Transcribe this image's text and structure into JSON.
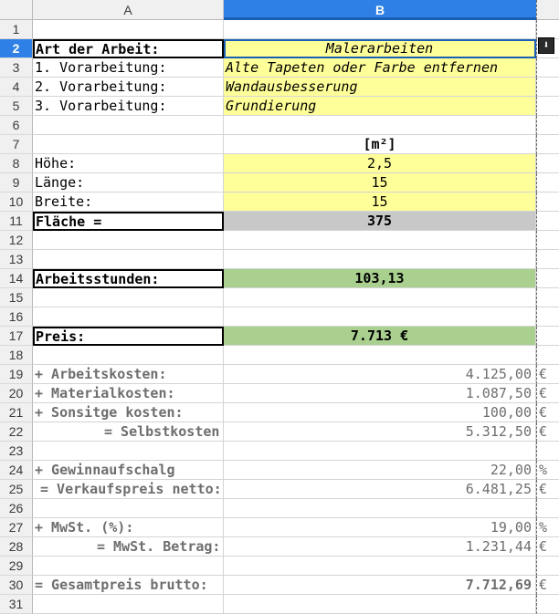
{
  "columns": {
    "a": "A",
    "b": "B"
  },
  "rows": [
    {
      "num": "1",
      "a": "",
      "b": "",
      "c": ""
    },
    {
      "num": "2",
      "a": "Art der Arbeit:",
      "b": "Malerarbeiten",
      "c": ""
    },
    {
      "num": "3",
      "a": "1. Vorarbeitung:",
      "b": "Alte Tapeten oder Farbe entfernen",
      "c": ""
    },
    {
      "num": "4",
      "a": "2. Vorarbeitung:",
      "b": "Wandausbesserung",
      "c": ""
    },
    {
      "num": "5",
      "a": "3. Vorarbeitung:",
      "b": "Grundierung",
      "c": ""
    },
    {
      "num": "6",
      "a": "",
      "b": "",
      "c": ""
    },
    {
      "num": "7",
      "a": "",
      "b": "[m²]",
      "c": ""
    },
    {
      "num": "8",
      "a": "Höhe:",
      "b": "2,5",
      "c": ""
    },
    {
      "num": "9",
      "a": "Länge:",
      "b": "15",
      "c": ""
    },
    {
      "num": "10",
      "a": "Breite:",
      "b": "15",
      "c": ""
    },
    {
      "num": "11",
      "a": "Fläche =",
      "b": "375",
      "c": ""
    },
    {
      "num": "12",
      "a": "",
      "b": "",
      "c": ""
    },
    {
      "num": "13",
      "a": "",
      "b": "",
      "c": ""
    },
    {
      "num": "14",
      "a": "Arbeitsstunden:",
      "b": "103,13",
      "c": ""
    },
    {
      "num": "15",
      "a": "",
      "b": "",
      "c": ""
    },
    {
      "num": "16",
      "a": "",
      "b": "",
      "c": ""
    },
    {
      "num": "17",
      "a": "Preis:",
      "b": "7.713 €",
      "c": ""
    },
    {
      "num": "18",
      "a": "",
      "b": "",
      "c": ""
    },
    {
      "num": "19",
      "a": "+ Arbeitskosten:",
      "b": "4.125,00",
      "c": "€"
    },
    {
      "num": "20",
      "a": "+ Materialkosten:",
      "b": "1.087,50",
      "c": "€"
    },
    {
      "num": "21",
      "a": "+ Sonsitge kosten:",
      "b": "100,00",
      "c": "€"
    },
    {
      "num": "22",
      "a": "= Selbstkosten",
      "b": "5.312,50",
      "c": "€"
    },
    {
      "num": "23",
      "a": "",
      "b": "",
      "c": ""
    },
    {
      "num": "24",
      "a": "+ Gewinnaufschalg",
      "b": "22,00",
      "c": "%"
    },
    {
      "num": "25",
      "a": "= Verkaufspreis netto:",
      "b": "6.481,25",
      "c": "€"
    },
    {
      "num": "26",
      "a": "",
      "b": "",
      "c": ""
    },
    {
      "num": "27",
      "a": "+ MwSt. (%):",
      "b": "19,00",
      "c": "%"
    },
    {
      "num": "28",
      "a": "= MwSt. Betrag:",
      "b": "1.231,44",
      "c": "€"
    },
    {
      "num": "29",
      "a": "",
      "b": "",
      "c": ""
    },
    {
      "num": "30",
      "a": "= Gesamtpreis brutto:",
      "b": "7.712,69",
      "c": "€"
    },
    {
      "num": "31",
      "a": "",
      "b": "",
      "c": ""
    }
  ],
  "dropdown_icon": "arrow-down-icon"
}
